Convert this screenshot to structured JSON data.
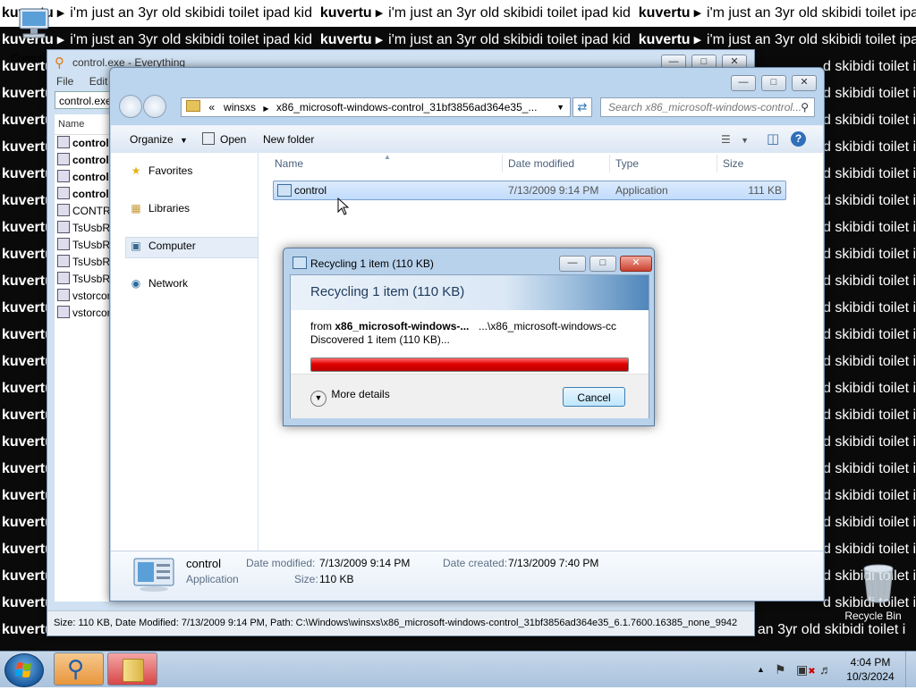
{
  "wallpaper": {
    "phrase": "i'm just an 3yr old skibidi toilet ipad kid",
    "name": "kuvertu",
    "dark_label": "kuvertu",
    "dark_tail": "d skibidi toilet i",
    "bottom_tail": "st an 3yr old skibidi toilet i"
  },
  "desktop_icons": {
    "computer_label": "Compu",
    "recycle_label": "Recycle Bin"
  },
  "everything": {
    "title": "control.exe - Everything",
    "menu": [
      "File",
      "Edit"
    ],
    "search_value": "control.exe",
    "col_name": "Name",
    "rows": [
      "control.",
      "control.",
      "control.",
      "control.",
      "CONTRO",
      "TsUsbRe",
      "TsUsbRe",
      "TsUsbRe",
      "TsUsbRe",
      "vstorcor",
      "vstorcor"
    ],
    "status": "Size: 110 KB, Date Modified: 7/13/2009 9:14 PM, Path: C:\\Windows\\winsxs\\x86_microsoft-windows-control_31bf3856ad364e35_6.1.7600.16385_none_9942"
  },
  "explorer": {
    "address": {
      "prefix": "«",
      "segment1": "winsxs",
      "segment2": "x86_microsoft-windows-control_31bf3856ad364e35_..."
    },
    "search_placeholder": "Search x86_microsoft-windows-control...",
    "toolbar": {
      "organize": "Organize",
      "open": "Open",
      "new_folder": "New folder"
    },
    "nav": {
      "favorites": "Favorites",
      "libraries": "Libraries",
      "computer": "Computer",
      "network": "Network"
    },
    "columns": {
      "name": "Name",
      "date_modified": "Date modified",
      "type": "Type",
      "size": "Size"
    },
    "file": {
      "name": "control",
      "date": "7/13/2009 9:14 PM",
      "type": "Application",
      "size": "111 KB"
    },
    "details": {
      "name": "control",
      "type": "Application",
      "date_modified_label": "Date modified:",
      "date_modified": "7/13/2009 9:14 PM",
      "size_label": "Size:",
      "size": "110 KB",
      "date_created_label": "Date created:",
      "date_created": "7/13/2009 7:40 PM"
    }
  },
  "dialog": {
    "title": "Recycling 1 item (110 KB)",
    "heading": "Recycling 1 item (110 KB)",
    "from_label": "from",
    "from_source": "x86_microsoft-windows-...",
    "from_dest": "...\\x86_microsoft-windows-cc",
    "discovered": "Discovered 1 item (110 KB)...",
    "progress": 1.0,
    "progress_color": "#e20000",
    "more_details": "More details",
    "cancel": "Cancel"
  },
  "taskbar": {
    "time": "4:04 PM",
    "date": "10/3/2024"
  }
}
